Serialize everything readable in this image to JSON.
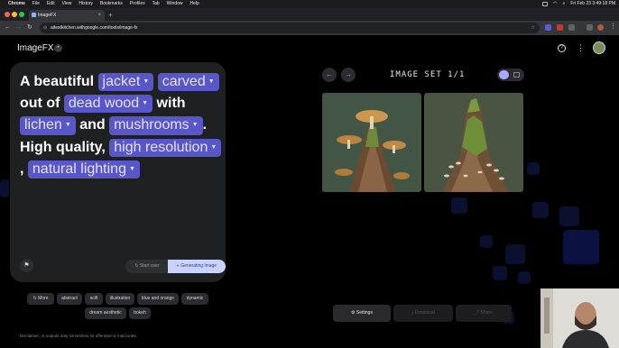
{
  "menubar": {
    "items": [
      "Chrome",
      "File",
      "Edit",
      "View",
      "History",
      "Bookmarks",
      "Profiles",
      "Tab",
      "Window",
      "Help"
    ],
    "clock": "Fri Feb 23  3:49:18 PM"
  },
  "browser": {
    "tab_title": "ImageFX",
    "url": "aitestkitchen.withgoogle.com/tools/image-fx"
  },
  "app": {
    "brand": "ImageFX",
    "prompt_parts": [
      {
        "type": "text",
        "value": "A beautiful "
      },
      {
        "type": "chip",
        "value": "jacket"
      },
      {
        "type": "chip",
        "value": "carved"
      },
      {
        "type": "text",
        "value": " out of "
      },
      {
        "type": "chip",
        "value": "dead wood"
      },
      {
        "type": "text",
        "value": " with "
      },
      {
        "type": "chip",
        "value": "lichen"
      },
      {
        "type": "text",
        "value": " and "
      },
      {
        "type": "chip",
        "value": "mushrooms"
      },
      {
        "type": "text",
        "value": ". High quality, "
      },
      {
        "type": "chip",
        "value": "high resolution"
      },
      {
        "type": "text",
        "value": " , "
      },
      {
        "type": "chip",
        "value": "natural lighting"
      }
    ],
    "start_over_label": "Start over",
    "generating_label": "Generating image",
    "style_chips": [
      "More",
      "abstract",
      "scifi",
      "illustration",
      "blue and orange",
      "dynamic",
      "dream aesthetic",
      "bokeh"
    ],
    "disclaimer": "Disclaimer: AI outputs may sometimes be offensive or inaccurate.",
    "image_set_title": "IMAGE SET 1/1",
    "bottom_actions": {
      "settings": "Settings",
      "download": "Download",
      "share": "Share"
    },
    "accent_color": "#5856c9"
  }
}
